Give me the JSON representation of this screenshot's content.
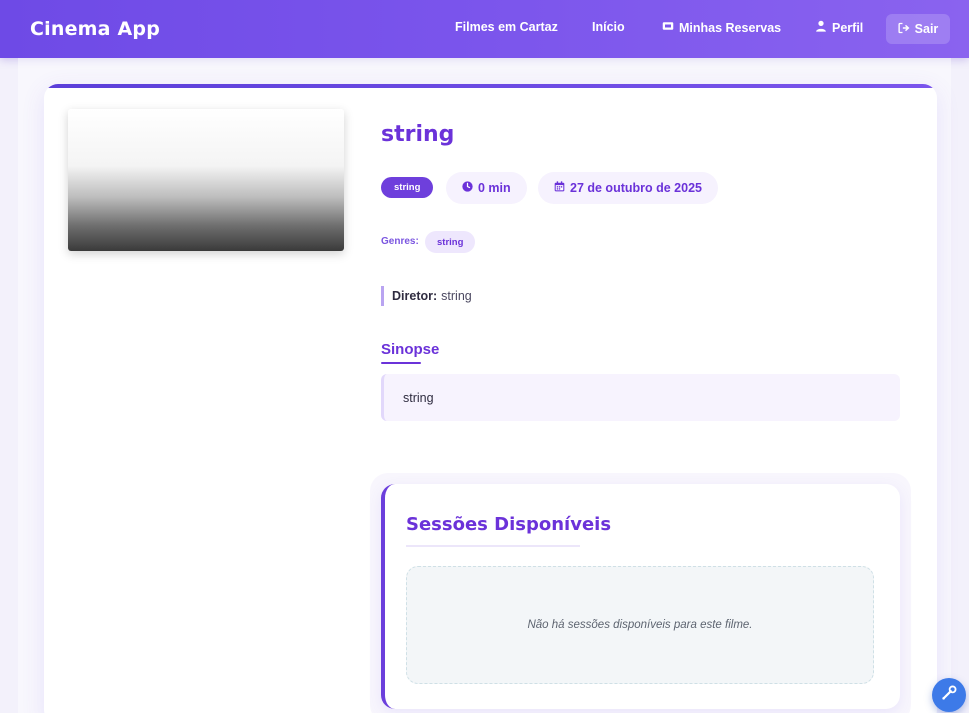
{
  "navbar": {
    "brand": "Cinema App",
    "links": {
      "movies": "Filmes em Cartaz",
      "home": "Início",
      "reservations": "Minhas Reservas",
      "profile": "Perfil",
      "logout": "Sair"
    },
    "icons": {
      "reservations": "ticket-icon",
      "profile": "user-icon",
      "logout": "sign-out-icon"
    }
  },
  "movie": {
    "title": "string",
    "classification": "string",
    "duration": "0 min",
    "release_date": "27 de outubro de 2025",
    "genres_label": "Genres:",
    "genres": [
      "string"
    ],
    "director_label": "Diretor:",
    "director": "string"
  },
  "synopsis": {
    "heading": "Sinopse",
    "text": "string"
  },
  "sessions": {
    "heading": "Sessões Disponíveis",
    "empty_message": "Não há sessões disponíveis para este filme."
  },
  "colors": {
    "accent": "#6b32d9",
    "navbar_start": "#6e4ae6",
    "navbar_end": "#8a63ef",
    "fab": "#3d7ae8"
  },
  "fab": {
    "icon": "wrench-icon"
  }
}
